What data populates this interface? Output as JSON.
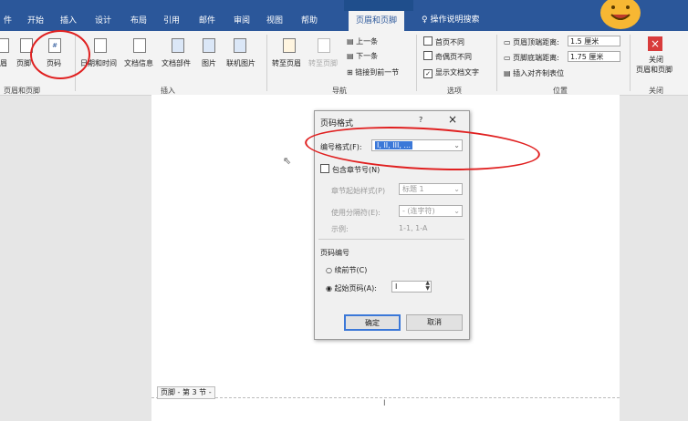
{
  "tabs": [
    "件",
    "开始",
    "插入",
    "设计",
    "布局",
    "引用",
    "邮件",
    "审阅",
    "视图",
    "帮助",
    "页眉和页脚"
  ],
  "search": "操作说明搜索",
  "ribbon": {
    "hf_group": {
      "items": [
        "眉",
        "页脚",
        "页码"
      ],
      "label": "页眉和页脚"
    },
    "insert_group": {
      "items": [
        "日期和时间",
        "文档信息",
        "文档部件",
        "图片",
        "联机图片"
      ],
      "label": "插入"
    },
    "nav_group": {
      "goto_header": "转至页眉",
      "goto_footer": "转至页脚",
      "prev": "上一条",
      "next": "下一条",
      "link": "链接到前一节",
      "label": "导航"
    },
    "options_group": {
      "opt1": "首页不同",
      "opt2": "奇偶页不同",
      "opt3": "显示文档文字",
      "label": "选项"
    },
    "position_group": {
      "top_label": "页眉顶端距离:",
      "top_value": "1.5 厘米",
      "bottom_label": "页脚底端距离:",
      "bottom_value": "1.75 厘米",
      "align_tab": "插入对齐制表位",
      "label": "位置"
    },
    "close_group": {
      "btn_line1": "关闭",
      "btn_line2": "页眉和页脚",
      "label": "关闭"
    }
  },
  "dialog": {
    "title": "页码格式",
    "help": "?",
    "close": "×",
    "format_label": "编号格式(F):",
    "format_value": "I, II, III, ...",
    "include_chapter": "包含章节号(N)",
    "chapter_style_label": "章节起始样式(P)",
    "chapter_style_value": "标题 1",
    "separator_label": "使用分隔符(E):",
    "separator_value": "-  (连字符)",
    "example_label": "示例:",
    "example_value": "1-1, 1-A",
    "page_numbering": "页码编号",
    "continue_prev": "续前节(C)",
    "start_at": "起始页码(A):",
    "start_value": "I",
    "ok": "确定",
    "cancel": "取消"
  },
  "footer_tag": "页脚 - 第 3 节 -",
  "colors": {
    "accent": "#2b579a",
    "annotation": "#e02020",
    "close_btn": "#d83b3b"
  }
}
